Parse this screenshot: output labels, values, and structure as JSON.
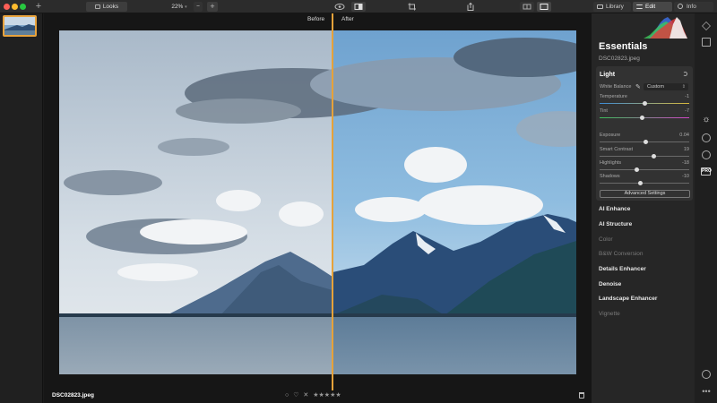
{
  "toolbar": {
    "add_label": "+",
    "looks_label": "Looks",
    "zoom_value": "22%",
    "zoom_minus": "−",
    "zoom_plus": "+",
    "tabs": [
      {
        "label": "Library",
        "icon": "library-icon"
      },
      {
        "label": "Edit",
        "icon": "sliders-icon",
        "active": true
      },
      {
        "label": "Info",
        "icon": "info-icon"
      }
    ]
  },
  "canvas": {
    "before_label": "Before",
    "after_label": "After",
    "file_name": "DSC02823.jpeg",
    "rating_stars": "★★★★★",
    "reject_icon": "✕",
    "heart_icon": "♡",
    "circle_icon": "○"
  },
  "panel": {
    "title": "Essentials",
    "file_name": "DSC02823.jpeg",
    "light": {
      "title": "Light",
      "white_balance_label": "White Balance",
      "white_balance_value": "Custom",
      "sliders": [
        {
          "label": "Temperature",
          "value": "-1",
          "position": 0.495
        },
        {
          "label": "Tint",
          "value": "-7",
          "position": 0.465
        },
        {
          "label": "Exposure",
          "value": "0.04",
          "position": 0.51
        },
        {
          "label": "Smart Contrast",
          "value": "19",
          "position": 0.595
        },
        {
          "label": "Highlights",
          "value": "-18",
          "position": 0.41
        },
        {
          "label": "Shadows",
          "value": "-10",
          "position": 0.45
        }
      ],
      "advanced_label": "Advanced Settings"
    },
    "sections": [
      {
        "label": "AI Enhance",
        "active": true
      },
      {
        "label": "AI Structure",
        "active": true
      },
      {
        "label": "Color",
        "active": false
      },
      {
        "label": "B&W Conversion",
        "active": false
      },
      {
        "label": "Details Enhancer",
        "active": true
      },
      {
        "label": "Denoise",
        "active": true
      },
      {
        "label": "Landscape Enhancer",
        "active": true
      },
      {
        "label": "Vignette",
        "active": false
      }
    ]
  },
  "colors": {
    "accent": "#e6a23a",
    "panel_bg": "#262626",
    "card_bg": "#323232"
  }
}
